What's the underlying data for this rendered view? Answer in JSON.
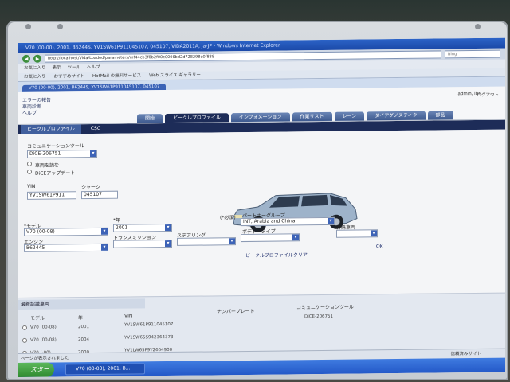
{
  "browser": {
    "title": "V70 (00-00), 2001, B6244S, YV1SW61P911045107, 045107, VIDA2011A, ja-JP - Windows Internet Explorer",
    "url": "http://localhost/Vida/Loaded/parameters/mf44cb3f8b2f00c0006bd2d728298e0f838",
    "search_placeholder": "Bing",
    "menu": [
      "お気に入り",
      "表示",
      "ツール",
      "ヘルプ"
    ],
    "favorites": [
      "お気に入り",
      "おすすめサイト",
      "HotMail の無料サービス",
      "Web スライス ギャラリー"
    ],
    "tab": "V70 (00-00), 2001, B6244S, YV1SW61P911045107, 045107"
  },
  "app": {
    "links": [
      "エラーの報告",
      "車両診断",
      "ヘルプ"
    ],
    "user": "admin, ibrl",
    "logout": "ログアウト",
    "tabs": [
      "開始",
      "ビークルプロファイル",
      "インフォメーション",
      "作業リスト",
      "レーン",
      "ダイアグノスティク",
      "部品"
    ],
    "active_tab": "ビークルプロファイル",
    "subnav": [
      "ビークルプロファイル",
      "CSC"
    ]
  },
  "form": {
    "comm_tool_label": "コミュニケーションツール",
    "comm_tool_value": "DiCE-206751",
    "comm_options": [
      "車両を読む",
      "DiCEアップデート"
    ],
    "vin_label": "VIN",
    "vin_value": "YV1SW61P911",
    "chassis_label": "シャーシ",
    "chassis_value": "045107",
    "required_note": "(*必須)",
    "model_label": "*モデル",
    "model_value": "V70 (00-08)",
    "year_label": "*年",
    "year_value": "2001",
    "engine_label": "エンジン",
    "engine_value": "B6244S",
    "transmission_label": "トランスミッション",
    "transmission_value": "",
    "steering_label": "ステアリング",
    "steering_value": "",
    "partner_label": "パートナーグループ",
    "partner_value": "INT, Arabia and China",
    "body_label": "ボディータイプ",
    "body_value": "",
    "special_label": "特殊車両",
    "special_value": "",
    "clear_link": "ビークルプロファイルクリア",
    "ok_link": "OK"
  },
  "recent": {
    "title": "最新認識車両",
    "columns": [
      "モデル",
      "年",
      "VIN",
      "ナンバープレート",
      "コミュニケーションツール"
    ],
    "rows": [
      {
        "model": "V70 (00-08)",
        "year": "2001",
        "vin": "YV1SW61P911045107",
        "plate": "",
        "tool": "DiCE-206751"
      },
      {
        "model": "V70 (00-08)",
        "year": "2004",
        "vin": "YV1SW65S942364373",
        "plate": "",
        "tool": ""
      },
      {
        "model": "V70 (-00)",
        "year": "2000",
        "vin": "YV1LW65F9Y2664900",
        "plate": "",
        "tool": ""
      }
    ]
  },
  "statusbar": {
    "left": "ページが表示されました",
    "right": "信頼済みサイト"
  },
  "taskbar": {
    "start": "スタート",
    "task": "V70 (00-00), 2001, B..."
  }
}
